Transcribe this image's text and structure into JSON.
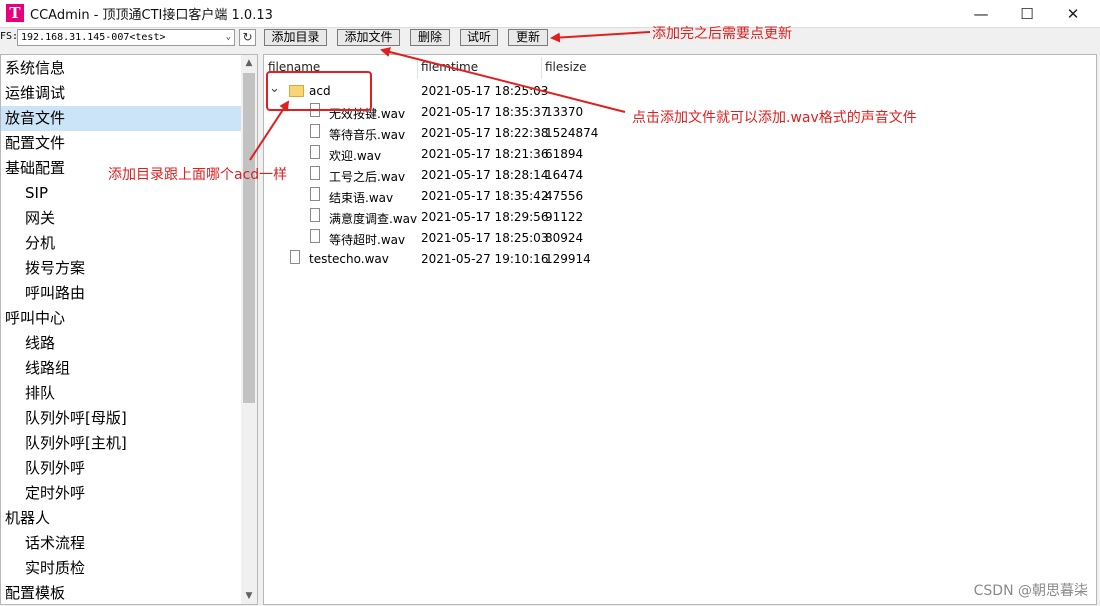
{
  "window": {
    "title": "CCAdmin - 顶顶通CTI接口客户端 1.0.13",
    "app_icon_letter": "T",
    "minimize_glyph": "—",
    "maximize_glyph": "☐",
    "close_glyph": "✕"
  },
  "toolbar": {
    "fs_label": "FS:",
    "fs_value": "192.168.31.145-007<test>",
    "fs_arrow": "⌄",
    "refresh_glyph": "↻",
    "buttons": [
      "添加目录",
      "添加文件",
      "删除",
      "试听",
      "更新"
    ]
  },
  "sidebar": {
    "items": [
      {
        "label": "系统信息",
        "indent": 0
      },
      {
        "label": "运维调试",
        "indent": 0
      },
      {
        "label": "放音文件",
        "indent": 0,
        "selected": true
      },
      {
        "label": "配置文件",
        "indent": 0
      },
      {
        "label": "基础配置",
        "indent": 0
      },
      {
        "label": "SIP",
        "indent": 1
      },
      {
        "label": "网关",
        "indent": 1
      },
      {
        "label": "分机",
        "indent": 1
      },
      {
        "label": "拨号方案",
        "indent": 1
      },
      {
        "label": "呼叫路由",
        "indent": 1
      },
      {
        "label": "呼叫中心",
        "indent": 0
      },
      {
        "label": "线路",
        "indent": 1
      },
      {
        "label": "线路组",
        "indent": 1
      },
      {
        "label": "排队",
        "indent": 1
      },
      {
        "label": "队列外呼[母版]",
        "indent": 1
      },
      {
        "label": "队列外呼[主机]",
        "indent": 1
      },
      {
        "label": "队列外呼",
        "indent": 1
      },
      {
        "label": "定时外呼",
        "indent": 1
      },
      {
        "label": "机器人",
        "indent": 0
      },
      {
        "label": "话术流程",
        "indent": 1
      },
      {
        "label": "实时质检",
        "indent": 1
      },
      {
        "label": "配置模板",
        "indent": 0
      }
    ],
    "scroll_up_glyph": "▲",
    "scroll_down_glyph": "▼"
  },
  "file_table": {
    "columns": [
      "filename",
      "filemtime",
      "filesize"
    ],
    "folder": {
      "name": "acd",
      "mtime": "2021-05-17 18:25:03",
      "expand_glyph": "⌄"
    },
    "folder_files": [
      {
        "name": "无效按键.wav",
        "mtime": "2021-05-17 18:35:37",
        "size": "13370"
      },
      {
        "name": "等待音乐.wav",
        "mtime": "2021-05-17 18:22:38",
        "size": "1524874"
      },
      {
        "name": "欢迎.wav",
        "mtime": "2021-05-17 18:21:36",
        "size": "61894"
      },
      {
        "name": "工号之后.wav",
        "mtime": "2021-05-17 18:28:14",
        "size": "16474"
      },
      {
        "name": "结束语.wav",
        "mtime": "2021-05-17 18:35:42",
        "size": "47556"
      },
      {
        "name": "满意度调查.wav",
        "mtime": "2021-05-17 18:29:56",
        "size": "91122"
      },
      {
        "name": "等待超时.wav",
        "mtime": "2021-05-17 18:25:03",
        "size": "80924"
      }
    ],
    "root_files": [
      {
        "name": "testecho.wav",
        "mtime": "2021-05-27 19:10:16",
        "size": "129914"
      }
    ]
  },
  "annotations": {
    "update_note": "添加完之后需要点更新",
    "add_file_note": "点击添加文件就可以添加.wav格式的声音文件",
    "add_dir_note": "添加目录跟上面哪个acd一样",
    "color": "#e02020"
  },
  "watermark": "CSDN @朝思暮柒",
  "colors": {
    "selected_row": "#cce4f7",
    "brand": "#e6007e"
  }
}
